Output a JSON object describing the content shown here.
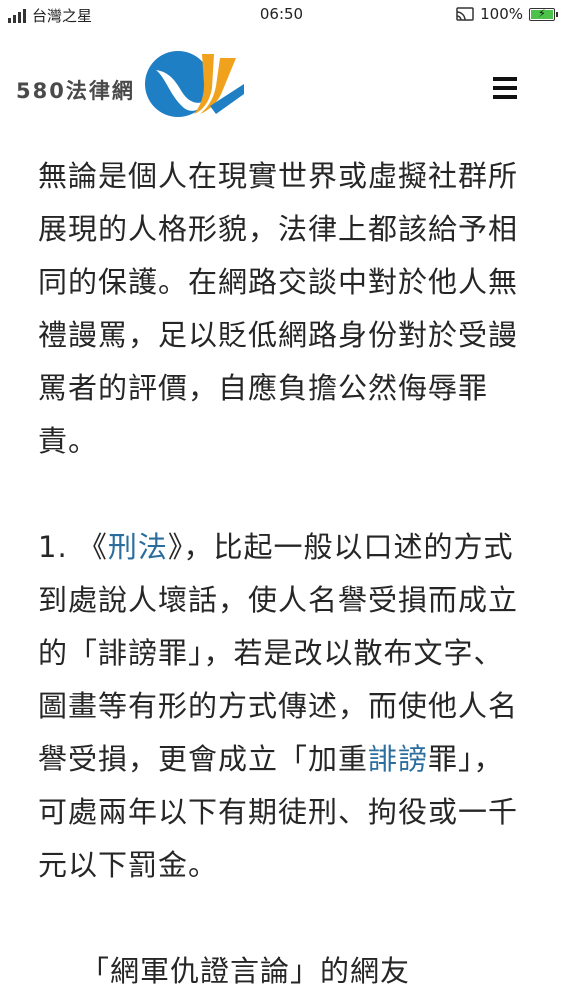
{
  "status_bar": {
    "carrier": "台灣之星",
    "time": "06:50",
    "battery": "100%"
  },
  "header": {
    "logo_text": "580法律網",
    "menu_icon": "hamburger-menu-icon"
  },
  "article": {
    "para1": "無論是個人在現實世界或虛擬社群所展現的人格形貌，法律上都該給予相同的保護。在網路交談中對於他人無禮謾罵，足以貶低網路身份對於受謾罵者的評價，自應負擔公然侮辱罪責。",
    "para2_num": "1. ",
    "para2_open": "《",
    "para2_link1": "刑法",
    "para2_close": "》",
    "para2_a": "，比起一般以口述的方式到處說人壞話，使人名譽受損而成立的「誹謗罪」，若是改以散布文字、圖畫等有形的方式傳述，而使他人名譽受損，更會成立「加重",
    "para2_link2": "誹謗",
    "para2_b": "罪」，可處兩年以下有期徒刑、拘役或一千元以下罰金。",
    "para3_partial": "「網軍仇證言論」的網友"
  },
  "colors": {
    "link": "#2b6e9e",
    "text": "#262626",
    "logo_blue": "#1f7fc4",
    "logo_orange": "#f0a21c"
  }
}
